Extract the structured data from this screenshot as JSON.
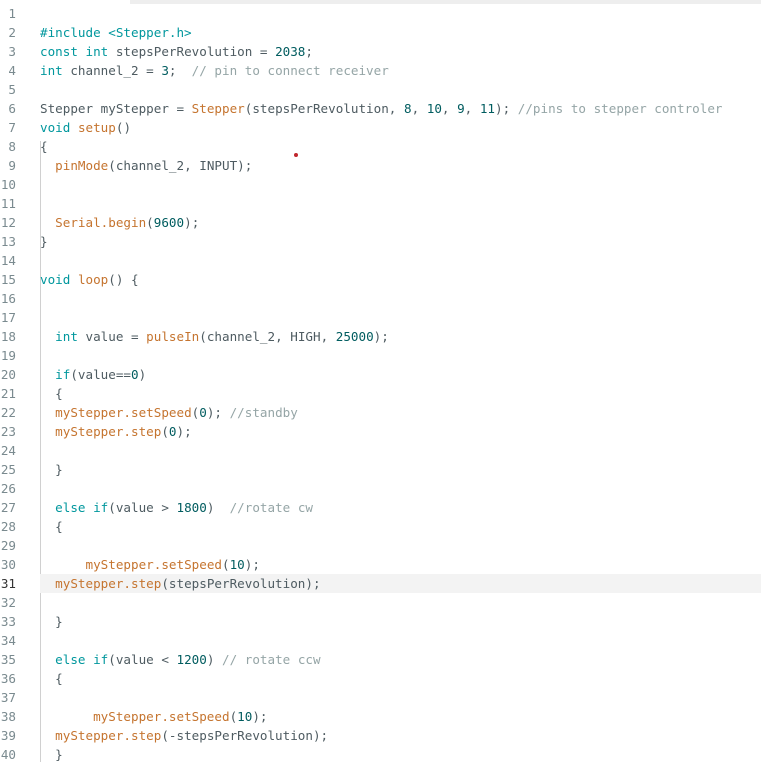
{
  "editor": {
    "current_line": 31,
    "lines": [
      [],
      [
        [
          "#include <Stepper.h>",
          "k"
        ]
      ],
      [
        [
          "const int",
          "k"
        ],
        [
          " stepsPerRevolution = ",
          "p"
        ],
        [
          "2038",
          "n"
        ],
        [
          ";",
          "p"
        ]
      ],
      [
        [
          "int",
          "k"
        ],
        [
          " channel_2 = ",
          "p"
        ],
        [
          "3",
          "n"
        ],
        [
          ";  ",
          "p"
        ],
        [
          "// pin to connect receiver",
          "c"
        ]
      ],
      [],
      [
        [
          "Stepper myStepper = ",
          "p"
        ],
        [
          "Stepper",
          "f"
        ],
        [
          "(stepsPerRevolution, ",
          "p"
        ],
        [
          "8",
          "n"
        ],
        [
          ", ",
          "p"
        ],
        [
          "10",
          "n"
        ],
        [
          ", ",
          "p"
        ],
        [
          "9",
          "n"
        ],
        [
          ", ",
          "p"
        ],
        [
          "11",
          "n"
        ],
        [
          "); ",
          "p"
        ],
        [
          "//pins to stepper controler",
          "c"
        ]
      ],
      [
        [
          "void",
          "k"
        ],
        [
          " ",
          "p"
        ],
        [
          "setup",
          "f"
        ],
        [
          "()",
          "p"
        ]
      ],
      [
        [
          "{",
          "p"
        ]
      ],
      [
        [
          "  ",
          "p"
        ],
        [
          "pinMode",
          "f"
        ],
        [
          "(channel_2, INPUT);",
          "p"
        ]
      ],
      [],
      [],
      [
        [
          "  ",
          "p"
        ],
        [
          "Serial.begin",
          "f"
        ],
        [
          "(",
          "p"
        ],
        [
          "9600",
          "n"
        ],
        [
          ");",
          "p"
        ]
      ],
      [
        [
          "}",
          "p"
        ]
      ],
      [],
      [
        [
          "void",
          "k"
        ],
        [
          " ",
          "p"
        ],
        [
          "loop",
          "f"
        ],
        [
          "() {",
          "p"
        ]
      ],
      [],
      [],
      [
        [
          "  ",
          "p"
        ],
        [
          "int",
          "k"
        ],
        [
          " value = ",
          "p"
        ],
        [
          "pulseIn",
          "f"
        ],
        [
          "(channel_2, HIGH, ",
          "p"
        ],
        [
          "25000",
          "n"
        ],
        [
          ");",
          "p"
        ]
      ],
      [],
      [
        [
          "  ",
          "p"
        ],
        [
          "if",
          "k"
        ],
        [
          "(value==",
          "p"
        ],
        [
          "0",
          "n"
        ],
        [
          ")",
          "p"
        ]
      ],
      [
        [
          "  {",
          "p"
        ]
      ],
      [
        [
          "  ",
          "p"
        ],
        [
          "myStepper.setSpeed",
          "f"
        ],
        [
          "(",
          "p"
        ],
        [
          "0",
          "n"
        ],
        [
          "); ",
          "p"
        ],
        [
          "//standby",
          "c"
        ]
      ],
      [
        [
          "  ",
          "p"
        ],
        [
          "myStepper.step",
          "f"
        ],
        [
          "(",
          "p"
        ],
        [
          "0",
          "n"
        ],
        [
          ");",
          "p"
        ]
      ],
      [],
      [
        [
          "  }",
          "p"
        ]
      ],
      [],
      [
        [
          "  ",
          "p"
        ],
        [
          "else if",
          "k"
        ],
        [
          "(value > ",
          "p"
        ],
        [
          "1800",
          "n"
        ],
        [
          ")  ",
          "p"
        ],
        [
          "//rotate cw",
          "c"
        ]
      ],
      [
        [
          "  {",
          "p"
        ]
      ],
      [],
      [
        [
          "      ",
          "p"
        ],
        [
          "myStepper.setSpeed",
          "f"
        ],
        [
          "(",
          "p"
        ],
        [
          "10",
          "n"
        ],
        [
          ");",
          "p"
        ]
      ],
      [
        [
          "  ",
          "p"
        ],
        [
          "myStepper.step",
          "f"
        ],
        [
          "(stepsPerRevolution);",
          "p"
        ]
      ],
      [],
      [
        [
          "  }",
          "p"
        ]
      ],
      [],
      [
        [
          "  ",
          "p"
        ],
        [
          "else if",
          "k"
        ],
        [
          "(value < ",
          "p"
        ],
        [
          "1200",
          "n"
        ],
        [
          ") ",
          "p"
        ],
        [
          "// rotate ccw",
          "c"
        ]
      ],
      [
        [
          "  {",
          "p"
        ]
      ],
      [],
      [
        [
          "       ",
          "p"
        ],
        [
          "myStepper.setSpeed",
          "f"
        ],
        [
          "(",
          "p"
        ],
        [
          "10",
          "n"
        ],
        [
          ");",
          "p"
        ]
      ],
      [
        [
          "  ",
          "p"
        ],
        [
          "myStepper.step",
          "f"
        ],
        [
          "(-stepsPerRevolution);",
          "p"
        ]
      ],
      [
        [
          "  }",
          "p"
        ]
      ]
    ]
  }
}
